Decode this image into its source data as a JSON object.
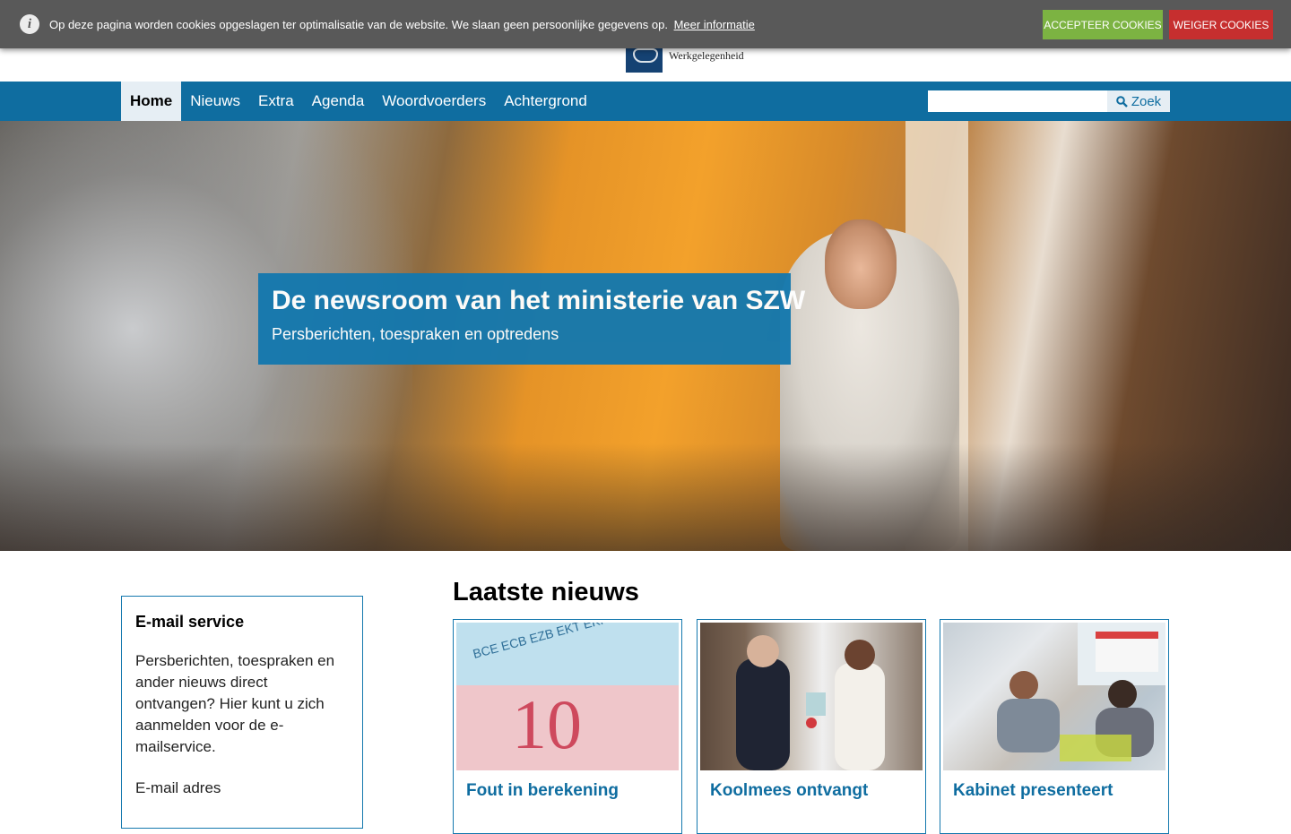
{
  "cookie_bar": {
    "text": "Op deze pagina worden cookies opgeslagen ter optimalisatie van de website. We slaan geen persoonlijke gegevens op.",
    "link": "Meer informatie",
    "accept": "Accepteer cookies",
    "decline": "Weiger cookies"
  },
  "logo": {
    "text": "Werkgelegenheid"
  },
  "nav": {
    "items": [
      {
        "label": "Home"
      },
      {
        "label": "Nieuws"
      },
      {
        "label": "Extra"
      },
      {
        "label": "Agenda"
      },
      {
        "label": "Woordvoerders"
      },
      {
        "label": "Achtergrond"
      }
    ],
    "active": "Home",
    "search_placeholder": "",
    "search_button": "Zoek"
  },
  "hero": {
    "title": "De newsroom van het ministerie van SZW",
    "subtitle": "Persberichten, toespraken en optredens"
  },
  "email_service": {
    "title": "E-mail service",
    "description": "Persberichten, toespraken en ander nieuws direct ontvangen? Hier kunt u zich aanmelden voor de e-mailservice.",
    "field_label": "E-mail adres"
  },
  "news": {
    "heading": "Laatste nieuws",
    "cards": [
      {
        "title": "Fout in berekening"
      },
      {
        "title": "Koolmees ontvangt"
      },
      {
        "title": "Kabinet presenteert"
      }
    ]
  },
  "colors": {
    "nav_bg": "#0f6da0",
    "accept_bg": "#7cb342",
    "decline_bg": "#c62f2f",
    "hero_box": "#1478ae"
  }
}
